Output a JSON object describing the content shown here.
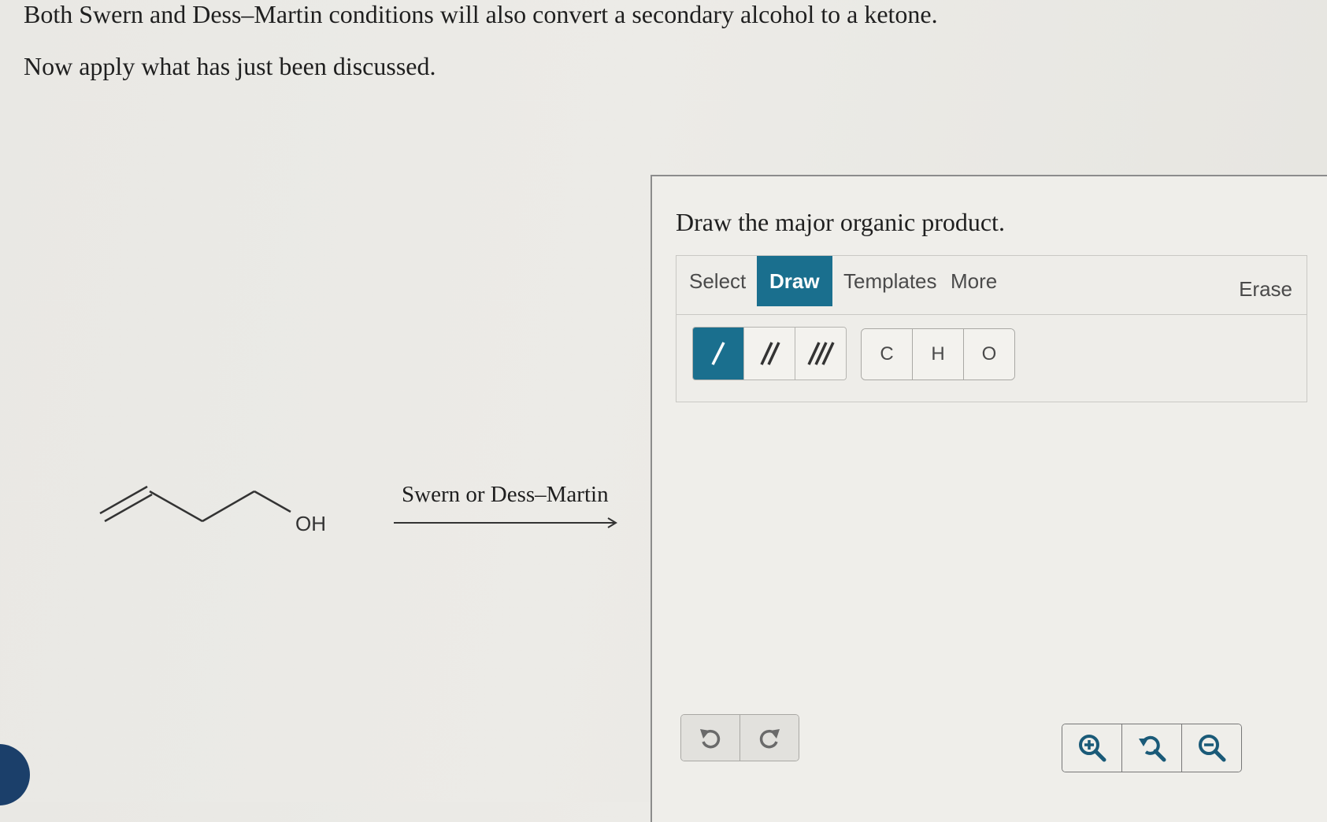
{
  "question": {
    "line1": "Both Swern and Dess–Martin conditions will also convert a secondary alcohol to a ketone.",
    "line2": "Now apply what has just been discussed."
  },
  "reaction": {
    "reactant_label": "OH",
    "reagent": "Swern or Dess–Martin"
  },
  "panel": {
    "prompt": "Draw the major organic product.",
    "tabs": [
      {
        "label": "Select",
        "active": false
      },
      {
        "label": "Draw",
        "active": true
      },
      {
        "label": "Templates",
        "active": false
      },
      {
        "label": "More",
        "active": false
      }
    ],
    "erase_label": "Erase",
    "bond_tools": [
      {
        "icon": "single-bond-icon",
        "active": true
      },
      {
        "icon": "double-bond-icon",
        "active": false
      },
      {
        "icon": "triple-bond-icon",
        "active": false
      }
    ],
    "atoms": [
      "C",
      "H",
      "O"
    ],
    "history_tools": [
      "undo-icon",
      "redo-icon"
    ],
    "zoom_tools": [
      "zoom-in-icon",
      "zoom-reset-icon",
      "zoom-out-icon"
    ]
  },
  "colors": {
    "accent": "#1a6f8e",
    "badge": "#1b3f6a"
  }
}
